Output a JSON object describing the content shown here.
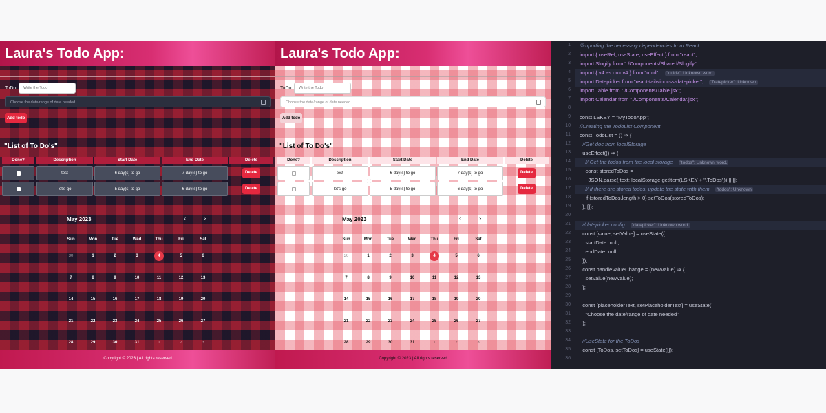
{
  "app": {
    "title": "Laura's Todo App:",
    "todo_label": "ToDo:",
    "todo_placeholder": "Write the Todo",
    "date_placeholder": "Choose the date/range of date needed",
    "add_button": "Add todo",
    "list_title": "\"List of To Do's\"",
    "columns": [
      "Done?",
      "Description",
      "Start Date",
      "End Date",
      "Delete"
    ],
    "rows": [
      {
        "description": "test",
        "start": "6 day(s) to go",
        "end": "7 day(s) to go",
        "delete": "Delete"
      },
      {
        "description": "let's go",
        "start": "5 day(s) to go",
        "end": "6 day(s) to go",
        "delete": "Delete"
      }
    ],
    "calendar": {
      "month": "May 2023",
      "prev": "‹",
      "next": "›",
      "weekdays": [
        "Sun",
        "Mon",
        "Tue",
        "Wed",
        "Thu",
        "Fri",
        "Sat"
      ],
      "weeks": [
        [
          "30",
          "1",
          "2",
          "3",
          "4",
          "5",
          "6"
        ],
        [
          "7",
          "8",
          "9",
          "10",
          "11",
          "12",
          "13"
        ],
        [
          "14",
          "15",
          "16",
          "17",
          "18",
          "19",
          "20"
        ],
        [
          "21",
          "22",
          "23",
          "24",
          "25",
          "26",
          "27"
        ],
        [
          "28",
          "29",
          "30",
          "31",
          "1",
          "2",
          "3"
        ]
      ],
      "today": "4"
    },
    "footer": "Copyright © 2023 | All rights reserved"
  },
  "colors": {
    "accent": "#e5283f",
    "header_gradient": "#d82e72",
    "editor_bg": "#1e1f29"
  },
  "editor": {
    "line_numbers": [
      "1",
      "2",
      "3",
      "4",
      "5",
      "6",
      "7",
      "8",
      "9",
      "10",
      "11",
      "12",
      "13",
      "14",
      "15",
      "16",
      "17",
      "18",
      "19",
      "20",
      "21",
      "22",
      "23",
      "24",
      "25",
      "26",
      "27",
      "28",
      "29",
      "30",
      "31",
      "32",
      "33",
      "34",
      "35",
      "36"
    ],
    "lines": [
      {
        "t": "//importing the necessary dependencies from React"
      },
      {
        "t": "import { useRef, useState, useEffect } from \"react\";"
      },
      {
        "t": "import Slugify from \"./Components/Shared/Slugify\";"
      },
      {
        "t": "import { v4 as uuidv4 } from \"uuid\";",
        "hint": "\"uuidv\": Unknown word."
      },
      {
        "t": "import Datepicker from \"react-tailwindcss-datepicker\";",
        "hint": "\"Datepicker\": Unknown"
      },
      {
        "t": "import Table from \"./Components/Table.jsx\";"
      },
      {
        "t": "import Calendar from \"./Components/Calendar.jsx\";"
      },
      {
        "t": ""
      },
      {
        "t": "const LSKEY = \"MyTodoApp\";"
      },
      {
        "t": "//Creating the TodoList Component"
      },
      {
        "t": "const TodoList = () ⇒ {"
      },
      {
        "t": "  //Get doc from localStorage"
      },
      {
        "t": "  useEffect(() ⇒ {"
      },
      {
        "t": "    // Get the todos from the local storage",
        "hint": "\"todos\": Unknown word."
      },
      {
        "t": "    const storedToDos ="
      },
      {
        "t": "      JSON.parse( text: localStorage.getItem(LSKEY + \".ToDos\")) || [];"
      },
      {
        "t": "    // If there are stored todos, update the state with them",
        "hint": "\"todos\": Unknown"
      },
      {
        "t": "    if (storedToDos.length > 0) setToDos(storedToDos);"
      },
      {
        "t": "  }, []);"
      },
      {
        "t": ""
      },
      {
        "t": "  //datepicker config",
        "hint": "\"datepicker\": Unknown word."
      },
      {
        "t": "  const [value, setValue] = useState({"
      },
      {
        "t": "    startDate: null,"
      },
      {
        "t": "    endDate: null,"
      },
      {
        "t": "  });"
      },
      {
        "t": "  const handleValueChange = (newValue) ⇒ {"
      },
      {
        "t": "    setValue(newValue);"
      },
      {
        "t": "  };"
      },
      {
        "t": ""
      },
      {
        "t": "  const [placeholderText, setPlaceholderText] = useState("
      },
      {
        "t": "    \"Choose the date/range of date needed\""
      },
      {
        "t": "  );"
      },
      {
        "t": ""
      },
      {
        "t": "  //UseState for the ToDos"
      },
      {
        "t": "  const [ToDos, setToDos] = useState([]);"
      },
      {
        "t": ""
      }
    ]
  }
}
